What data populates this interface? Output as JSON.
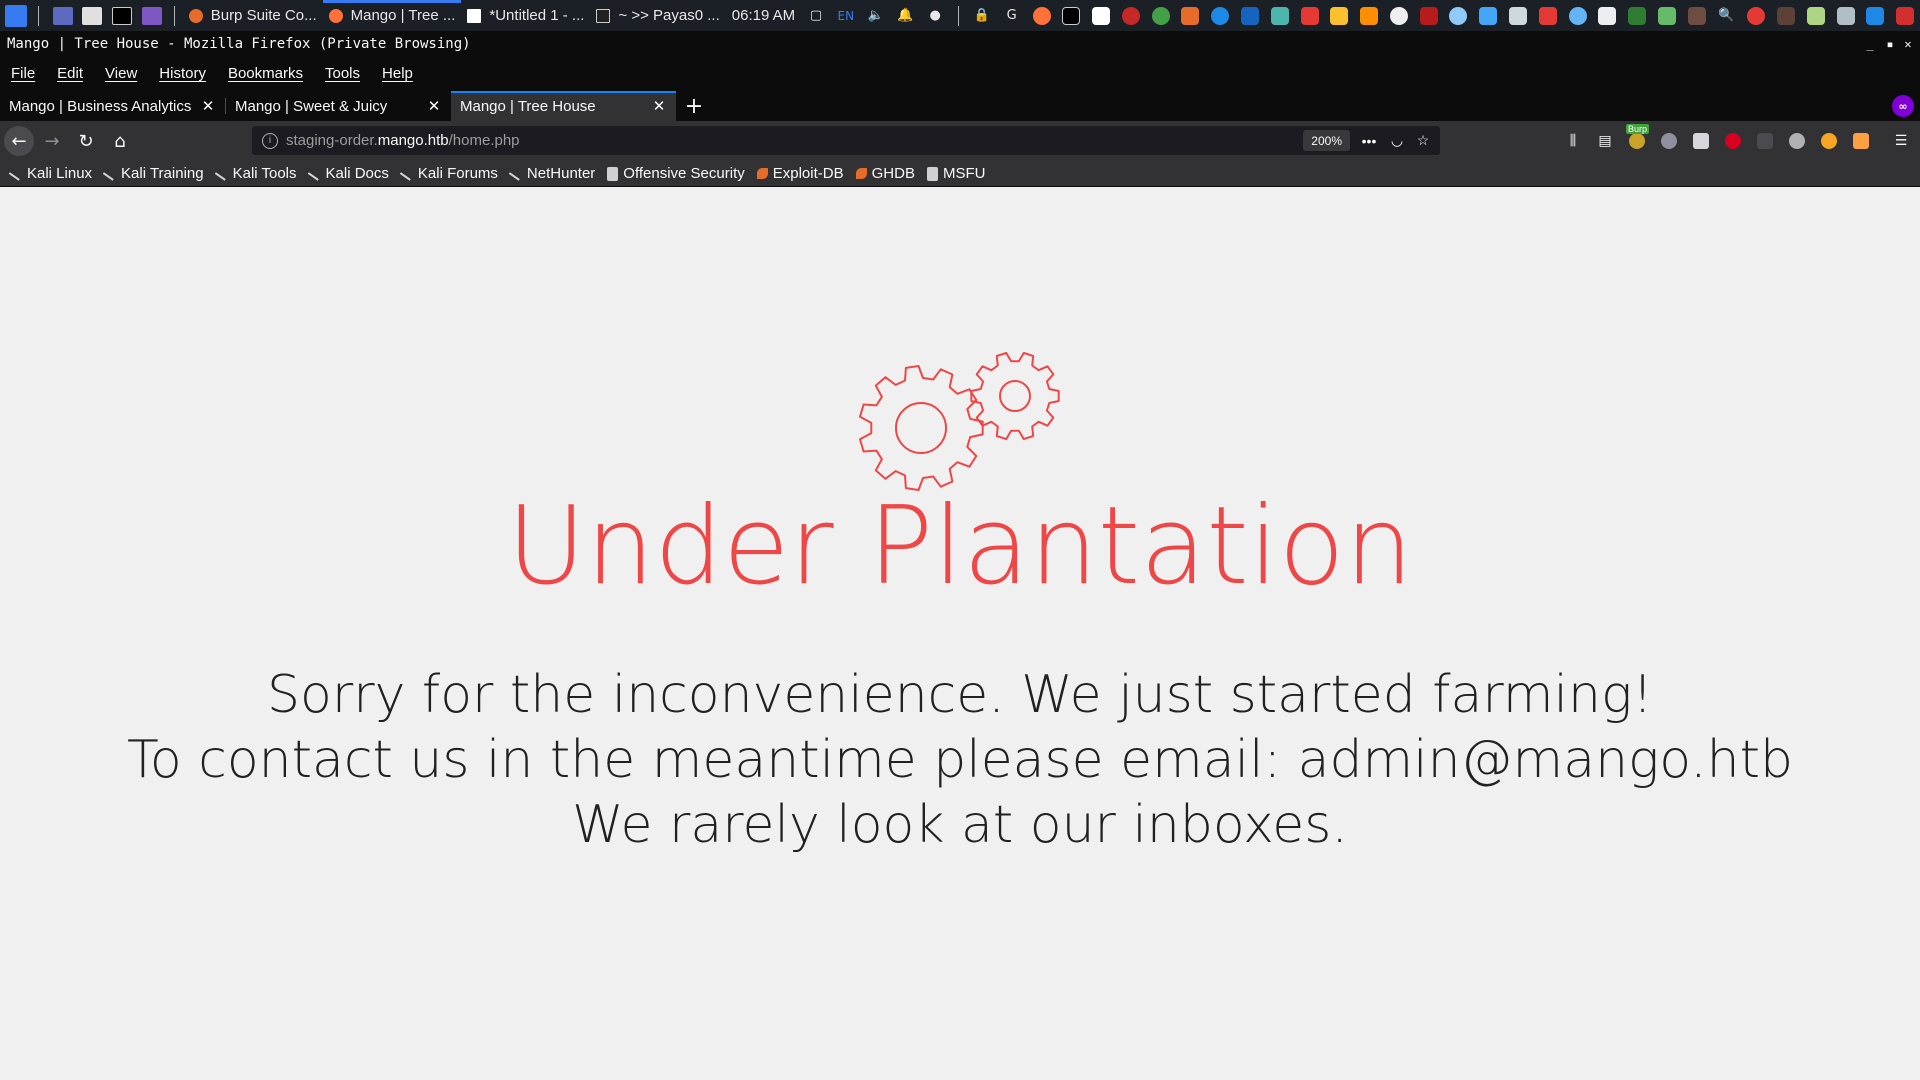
{
  "system_panel": {
    "tasks": [
      {
        "label": "Burp Suite Co...",
        "icon_color": "#e66c2c"
      },
      {
        "label": "Mango | Tree ...",
        "icon_color": "#ff7139"
      },
      {
        "label": "*Untitled 1 - ...",
        "icon_color": "#ffffff"
      },
      {
        "label": "~ >> Payas0 ...",
        "icon_color": "#cccccc"
      }
    ],
    "clock": "06:19 AM",
    "keyboard_layout": "EN"
  },
  "window": {
    "title": "Mango | Tree House - Mozilla Firefox (Private Browsing)"
  },
  "menu": [
    "File",
    "Edit",
    "View",
    "History",
    "Bookmarks",
    "Tools",
    "Help"
  ],
  "tabs": [
    {
      "label": "Mango | Business Analytics",
      "active": false
    },
    {
      "label": "Mango | Sweet & Juicy",
      "active": false
    },
    {
      "label": "Mango | Tree House",
      "active": true
    }
  ],
  "url": {
    "prefix": "staging-order.",
    "host": "mango.htb",
    "path": "/home.php",
    "zoom": "200%"
  },
  "toolbar": {
    "burp_badge": "Burp"
  },
  "bookmarks": [
    {
      "label": "Kali Linux",
      "icon": "kali-dragon-icon"
    },
    {
      "label": "Kali Training",
      "icon": "kali-dragon-icon"
    },
    {
      "label": "Kali Tools",
      "icon": "kali-dragon-icon"
    },
    {
      "label": "Kali Docs",
      "icon": "kali-dragon-icon"
    },
    {
      "label": "Kali Forums",
      "icon": "kali-dragon-icon"
    },
    {
      "label": "NetHunter",
      "icon": "kali-dragon-icon"
    },
    {
      "label": "Offensive Security",
      "icon": "offsec-icon"
    },
    {
      "label": "Exploit-DB",
      "icon": "exploit-db-icon"
    },
    {
      "label": "GHDB",
      "icon": "exploit-db-icon"
    },
    {
      "label": "MSFU",
      "icon": "offsec-icon"
    }
  ],
  "page": {
    "headline": "Under Plantation",
    "line1": "Sorry for the inconvenience. We just started farming!",
    "line2": "To contact us in the meantime please email: admin@mango.htb",
    "line3": "We rarely look at our inboxes.",
    "accent_color": "#ed4747",
    "text_color": "#212121",
    "background": "#f1f0f1"
  }
}
